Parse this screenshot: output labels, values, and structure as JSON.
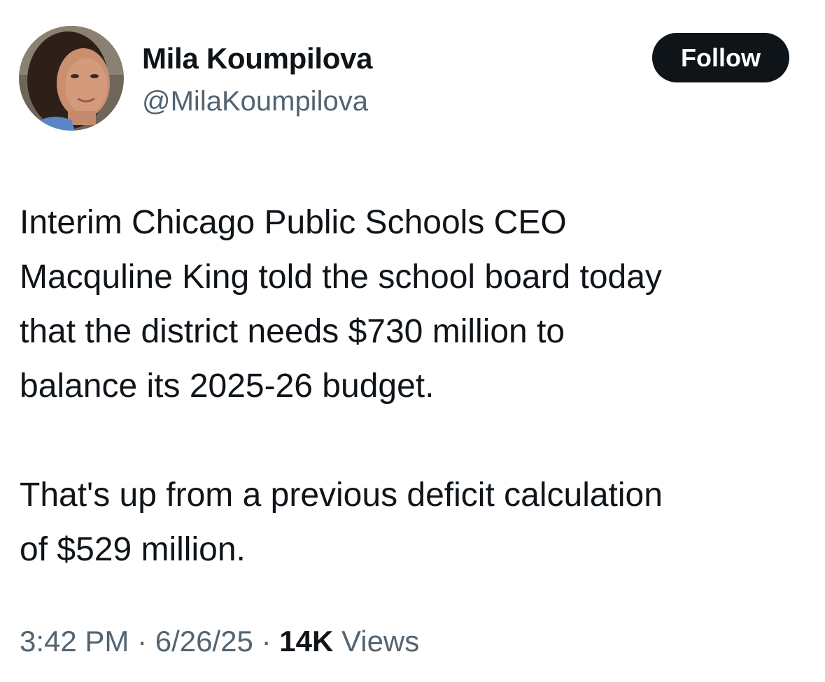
{
  "author": {
    "name": "Mila Koumpilova",
    "handle": "@MilaKoumpilova",
    "avatar_icon": "profile-photo"
  },
  "follow_button": {
    "label": "Follow"
  },
  "tweet": {
    "paragraph_1": "Interim Chicago Public Schools CEO\nMacquline King told the school board today\nthat the district needs $730 million to\nbalance its 2025-26 budget.",
    "paragraph_2": "That's up from a previous deficit calculation\nof $529 million."
  },
  "meta": {
    "time": "3:42 PM",
    "separator": "·",
    "date": "6/26/25",
    "views_count": "14K",
    "views_label": "Views"
  },
  "colors": {
    "text": "#0f1419",
    "secondary_text": "#536471",
    "follow_bg": "#0f1419",
    "follow_text": "#ffffff"
  }
}
